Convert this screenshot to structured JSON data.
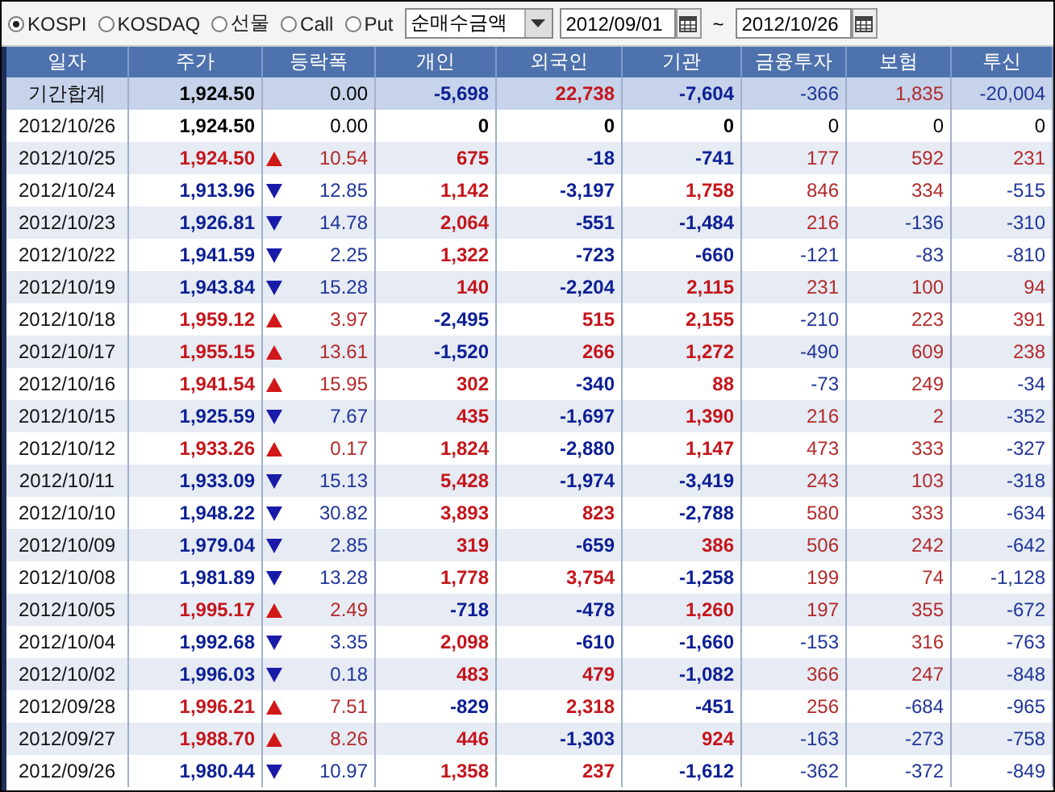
{
  "toolbar": {
    "markets": [
      {
        "label": "KOSPI",
        "selected": true
      },
      {
        "label": "KOSDAQ",
        "selected": false
      },
      {
        "label": "선물",
        "selected": false
      },
      {
        "label": "Call",
        "selected": false
      },
      {
        "label": "Put",
        "selected": false
      }
    ],
    "measure": "순매수금액",
    "start_date": "2012/09/01",
    "separator": "~",
    "end_date": "2012/10/26"
  },
  "table": {
    "columns": [
      "일자",
      "주가",
      "등락폭",
      "개인",
      "외국인",
      "기관",
      "금융투자",
      "보험",
      "투신"
    ],
    "summary": {
      "date": "기간합계",
      "price": "1,924.50",
      "kind": "flat",
      "change": "0.00",
      "values": [
        "-5,698",
        "22,738",
        "-7,604",
        "-366",
        "1,835",
        "-20,004"
      ]
    },
    "rows": [
      {
        "date": "2012/10/26",
        "price": "1,924.50",
        "kind": "flat",
        "change": "0.00",
        "values": [
          "0",
          "0",
          "0",
          "0",
          "0",
          "0"
        ]
      },
      {
        "date": "2012/10/25",
        "price": "1,924.50",
        "kind": "up",
        "change": "10.54",
        "values": [
          "675",
          "-18",
          "-741",
          "177",
          "592",
          "231"
        ]
      },
      {
        "date": "2012/10/24",
        "price": "1,913.96",
        "kind": "down",
        "change": "12.85",
        "values": [
          "1,142",
          "-3,197",
          "1,758",
          "846",
          "334",
          "-515"
        ]
      },
      {
        "date": "2012/10/23",
        "price": "1,926.81",
        "kind": "down",
        "change": "14.78",
        "values": [
          "2,064",
          "-551",
          "-1,484",
          "216",
          "-136",
          "-310"
        ]
      },
      {
        "date": "2012/10/22",
        "price": "1,941.59",
        "kind": "down",
        "change": "2.25",
        "values": [
          "1,322",
          "-723",
          "-660",
          "-121",
          "-83",
          "-810"
        ]
      },
      {
        "date": "2012/10/19",
        "price": "1,943.84",
        "kind": "down",
        "change": "15.28",
        "values": [
          "140",
          "-2,204",
          "2,115",
          "231",
          "100",
          "94"
        ]
      },
      {
        "date": "2012/10/18",
        "price": "1,959.12",
        "kind": "up",
        "change": "3.97",
        "values": [
          "-2,495",
          "515",
          "2,155",
          "-210",
          "223",
          "391"
        ]
      },
      {
        "date": "2012/10/17",
        "price": "1,955.15",
        "kind": "up",
        "change": "13.61",
        "values": [
          "-1,520",
          "266",
          "1,272",
          "-490",
          "609",
          "238"
        ]
      },
      {
        "date": "2012/10/16",
        "price": "1,941.54",
        "kind": "up",
        "change": "15.95",
        "values": [
          "302",
          "-340",
          "88",
          "-73",
          "249",
          "-34"
        ]
      },
      {
        "date": "2012/10/15",
        "price": "1,925.59",
        "kind": "down",
        "change": "7.67",
        "values": [
          "435",
          "-1,697",
          "1,390",
          "216",
          "2",
          "-352"
        ]
      },
      {
        "date": "2012/10/12",
        "price": "1,933.26",
        "kind": "up",
        "change": "0.17",
        "values": [
          "1,824",
          "-2,880",
          "1,147",
          "473",
          "333",
          "-327"
        ]
      },
      {
        "date": "2012/10/11",
        "price": "1,933.09",
        "kind": "down",
        "change": "15.13",
        "values": [
          "5,428",
          "-1,974",
          "-3,419",
          "243",
          "103",
          "-318"
        ]
      },
      {
        "date": "2012/10/10",
        "price": "1,948.22",
        "kind": "down",
        "change": "30.82",
        "values": [
          "3,893",
          "823",
          "-2,788",
          "580",
          "333",
          "-634"
        ]
      },
      {
        "date": "2012/10/09",
        "price": "1,979.04",
        "kind": "down",
        "change": "2.85",
        "values": [
          "319",
          "-659",
          "386",
          "506",
          "242",
          "-642"
        ]
      },
      {
        "date": "2012/10/08",
        "price": "1,981.89",
        "kind": "down",
        "change": "13.28",
        "values": [
          "1,778",
          "3,754",
          "-1,258",
          "199",
          "74",
          "-1,128"
        ]
      },
      {
        "date": "2012/10/05",
        "price": "1,995.17",
        "kind": "up",
        "change": "2.49",
        "values": [
          "-718",
          "-478",
          "1,260",
          "197",
          "355",
          "-672"
        ]
      },
      {
        "date": "2012/10/04",
        "price": "1,992.68",
        "kind": "down",
        "change": "3.35",
        "values": [
          "2,098",
          "-610",
          "-1,660",
          "-153",
          "316",
          "-763"
        ]
      },
      {
        "date": "2012/10/02",
        "price": "1,996.03",
        "kind": "down",
        "change": "0.18",
        "values": [
          "483",
          "479",
          "-1,082",
          "366",
          "247",
          "-848"
        ]
      },
      {
        "date": "2012/09/28",
        "price": "1,996.21",
        "kind": "up",
        "change": "7.51",
        "values": [
          "-829",
          "2,318",
          "-451",
          "256",
          "-684",
          "-965"
        ]
      },
      {
        "date": "2012/09/27",
        "price": "1,988.70",
        "kind": "up",
        "change": "8.26",
        "values": [
          "446",
          "-1,303",
          "924",
          "-163",
          "-273",
          "-758"
        ]
      },
      {
        "date": "2012/09/26",
        "price": "1,980.44",
        "kind": "down",
        "change": "10.97",
        "values": [
          "1,358",
          "237",
          "-1,612",
          "-362",
          "-372",
          "-849"
        ]
      }
    ]
  }
}
